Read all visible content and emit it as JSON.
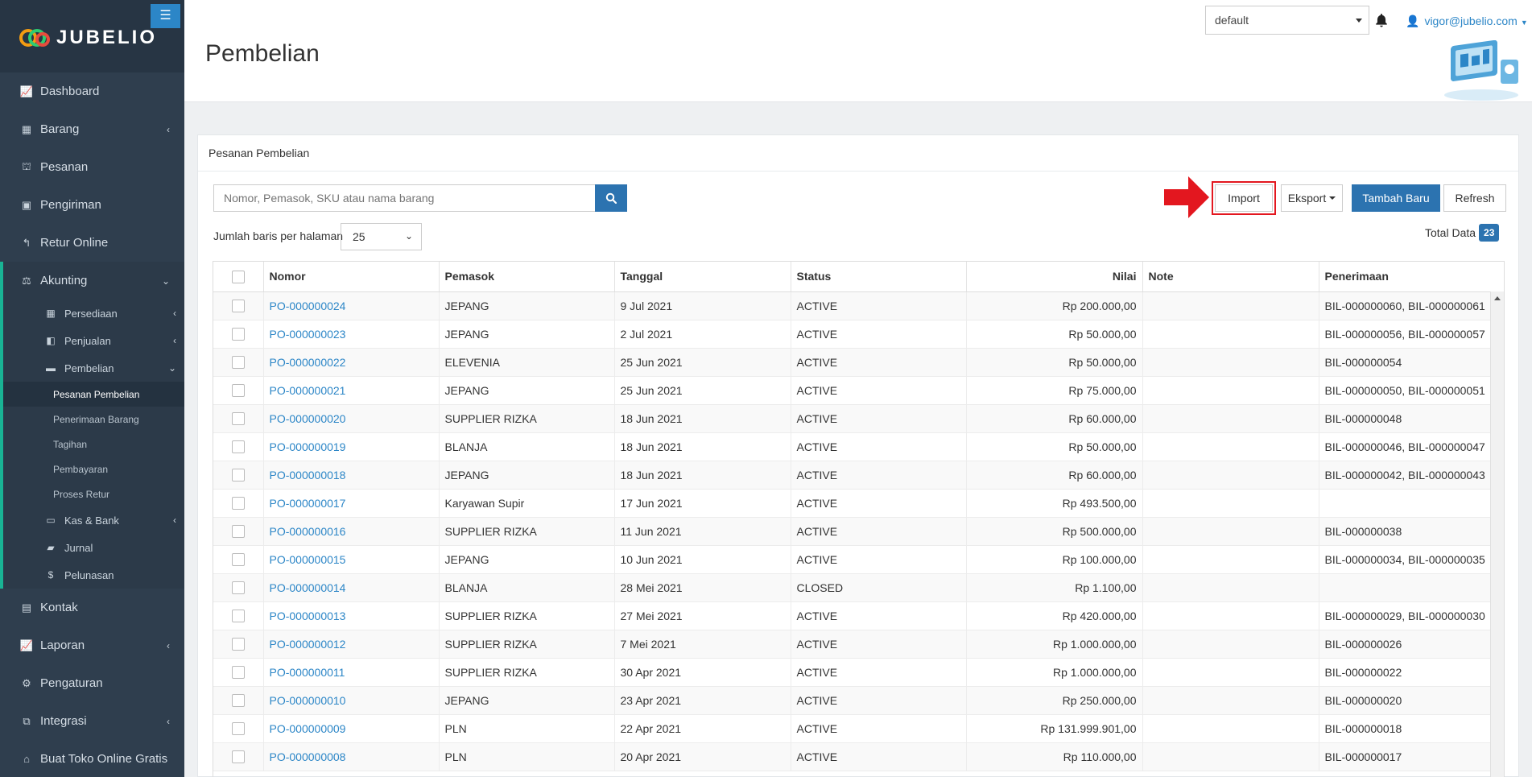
{
  "brand": {
    "name": "JUBELIO"
  },
  "sidebar": {
    "menu_icon": "hamburger-icon",
    "items": [
      {
        "label": "Dashboard",
        "icon": "area-chart-icon"
      },
      {
        "label": "Barang",
        "icon": "cubes-icon"
      },
      {
        "label": "Pesanan",
        "icon": "basket-icon"
      },
      {
        "label": "Pengiriman",
        "icon": "truck-icon"
      },
      {
        "label": "Retur Online",
        "icon": "reply-icon"
      }
    ],
    "akunting": {
      "label": "Akunting",
      "sub": [
        {
          "label": "Persediaan"
        },
        {
          "label": "Penjualan"
        },
        {
          "label": "Pembelian"
        }
      ],
      "pembelian_sub": [
        "Pesanan Pembelian",
        "Penerimaan Barang",
        "Tagihan",
        "Pembayaran",
        "Proses Retur"
      ],
      "after": [
        {
          "label": "Kas & Bank"
        },
        {
          "label": "Jurnal"
        },
        {
          "label": "Pelunasan"
        }
      ]
    },
    "bottom": [
      {
        "label": "Kontak",
        "icon": "address-card-icon"
      },
      {
        "label": "Laporan",
        "icon": "line-chart-icon"
      },
      {
        "label": "Pengaturan",
        "icon": "cogs-icon"
      },
      {
        "label": "Integrasi",
        "icon": "sitemap-icon"
      },
      {
        "label": "Buat Toko Online Gratis",
        "icon": "store-icon"
      }
    ]
  },
  "header": {
    "title": "Pembelian",
    "branch": "default",
    "user": "vigor@jubelio.com"
  },
  "panel": {
    "heading": "Pesanan Pembelian",
    "search_placeholder": "Nomor, Pemasok, SKU atau nama barang",
    "rows_label": "Jumlah baris per halaman",
    "rows_value": "25",
    "buttons": {
      "import": "Import",
      "export": "Eksport",
      "add": "Tambah Baru",
      "refresh": "Refresh"
    },
    "total_label": "Total Data",
    "total_value": "23"
  },
  "table": {
    "columns": [
      "Nomor",
      "Pemasok",
      "Tanggal",
      "Status",
      "Nilai",
      "Note",
      "Penerimaan"
    ],
    "rows": [
      [
        "PO-000000024",
        "JEPANG",
        "9 Jul 2021",
        "ACTIVE",
        "Rp 200.000,00",
        "",
        "BIL-000000060, BIL-000000061"
      ],
      [
        "PO-000000023",
        "JEPANG",
        "2 Jul 2021",
        "ACTIVE",
        "Rp 50.000,00",
        "",
        "BIL-000000056, BIL-000000057"
      ],
      [
        "PO-000000022",
        "ELEVENIA",
        "25 Jun 2021",
        "ACTIVE",
        "Rp 50.000,00",
        "",
        "BIL-000000054"
      ],
      [
        "PO-000000021",
        "JEPANG",
        "25 Jun 2021",
        "ACTIVE",
        "Rp 75.000,00",
        "",
        "BIL-000000050, BIL-000000051"
      ],
      [
        "PO-000000020",
        "SUPPLIER RIZKA",
        "18 Jun 2021",
        "ACTIVE",
        "Rp 60.000,00",
        "",
        "BIL-000000048"
      ],
      [
        "PO-000000019",
        "BLANJA",
        "18 Jun 2021",
        "ACTIVE",
        "Rp 50.000,00",
        "",
        "BIL-000000046, BIL-000000047"
      ],
      [
        "PO-000000018",
        "JEPANG",
        "18 Jun 2021",
        "ACTIVE",
        "Rp 60.000,00",
        "",
        "BIL-000000042, BIL-000000043"
      ],
      [
        "PO-000000017",
        "Karyawan Supir",
        "17 Jun 2021",
        "ACTIVE",
        "Rp 493.500,00",
        "",
        ""
      ],
      [
        "PO-000000016",
        "SUPPLIER RIZKA",
        "11 Jun 2021",
        "ACTIVE",
        "Rp 500.000,00",
        "",
        "BIL-000000038"
      ],
      [
        "PO-000000015",
        "JEPANG",
        "10 Jun 2021",
        "ACTIVE",
        "Rp 100.000,00",
        "",
        "BIL-000000034, BIL-000000035"
      ],
      [
        "PO-000000014",
        "BLANJA",
        "28 Mei 2021",
        "CLOSED",
        "Rp 1.100,00",
        "",
        ""
      ],
      [
        "PO-000000013",
        "SUPPLIER RIZKA",
        "27 Mei 2021",
        "ACTIVE",
        "Rp 420.000,00",
        "",
        "BIL-000000029, BIL-000000030"
      ],
      [
        "PO-000000012",
        "SUPPLIER RIZKA",
        "7 Mei 2021",
        "ACTIVE",
        "Rp 1.000.000,00",
        "",
        "BIL-000000026"
      ],
      [
        "PO-000000011",
        "SUPPLIER RIZKA",
        "30 Apr 2021",
        "ACTIVE",
        "Rp 1.000.000,00",
        "",
        "BIL-000000022"
      ],
      [
        "PO-000000010",
        "JEPANG",
        "23 Apr 2021",
        "ACTIVE",
        "Rp 250.000,00",
        "",
        "BIL-000000020"
      ],
      [
        "PO-000000009",
        "PLN",
        "22 Apr 2021",
        "ACTIVE",
        "Rp 131.999.901,00",
        "",
        "BIL-000000018"
      ],
      [
        "PO-000000008",
        "PLN",
        "20 Apr 2021",
        "ACTIVE",
        "Rp 110.000,00",
        "",
        "BIL-000000017"
      ]
    ]
  }
}
